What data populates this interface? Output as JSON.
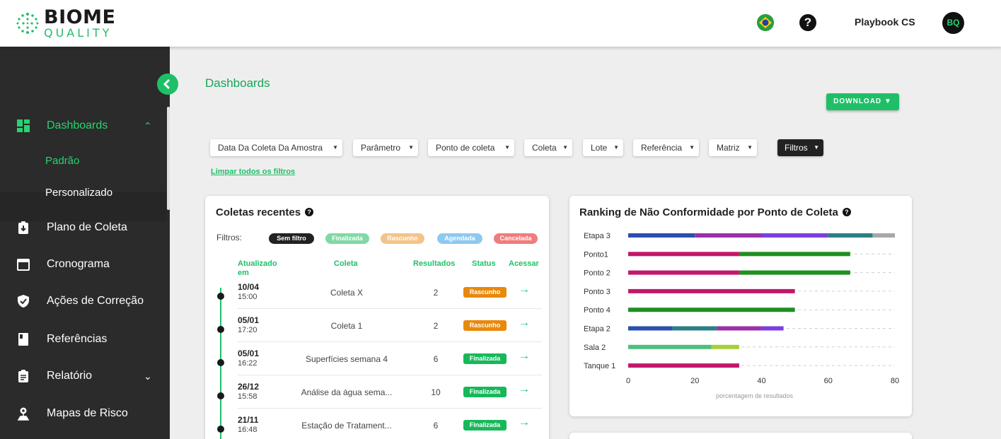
{
  "header": {
    "logo_main": "BIOME",
    "logo_sub": "QUALITY",
    "help": "?",
    "workspace": "Playbook CS",
    "avatar_initials": "BQ"
  },
  "sidebar": {
    "items": [
      {
        "label": "Dashboards",
        "icon": "dashboard-icon",
        "active": true,
        "expanded": true
      },
      {
        "label": "Plano de Coleta",
        "icon": "clipboard-download-icon"
      },
      {
        "label": "Cronograma",
        "icon": "calendar-icon"
      },
      {
        "label": "Ações de Correção",
        "icon": "shield-check-icon"
      },
      {
        "label": "Referências",
        "icon": "book-icon"
      },
      {
        "label": "Relatório",
        "icon": "clipboard-list-icon",
        "has_children": true
      },
      {
        "label": "Mapas de Risco",
        "icon": "map-pin-icon"
      }
    ],
    "subitems": [
      {
        "label": "Padrão",
        "active": true
      },
      {
        "label": "Personalizado"
      }
    ]
  },
  "main": {
    "title": "Dashboards",
    "download_label": "DOWNLOAD",
    "filters": [
      "Data Da Coleta Da Amostra",
      "Parâmetro",
      "Ponto de coleta",
      "Coleta",
      "Lote",
      "Referência",
      "Matriz",
      "Filtros"
    ],
    "clear_filters": "Limpar todos os filtros"
  },
  "recent": {
    "title": "Coletas recentes",
    "help": "?",
    "filters_label": "Filtros:",
    "chips": [
      {
        "label": "Sem filtro",
        "color": "#222222"
      },
      {
        "label": "Finalizada",
        "color": "#7fd9a6"
      },
      {
        "label": "Rascunho",
        "color": "#f3c48a"
      },
      {
        "label": "Agendada",
        "color": "#8ec9ee"
      },
      {
        "label": "Cancelada",
        "color": "#ee7d7d"
      }
    ],
    "columns": {
      "updated": "Atualizado em",
      "coleta": "Coleta",
      "results": "Resultados",
      "status": "Status",
      "access": "Acessar"
    },
    "rows": [
      {
        "date": "10/04",
        "time": "15:00",
        "name": "Coleta X",
        "results": "2",
        "status": "Rascunho",
        "status_color": "#e8890c"
      },
      {
        "date": "05/01",
        "time": "17:20",
        "name": "Coleta 1",
        "results": "2",
        "status": "Rascunho",
        "status_color": "#e8890c"
      },
      {
        "date": "05/01",
        "time": "16:22",
        "name": "Superfícies semana 4",
        "results": "6",
        "status": "Finalizada",
        "status_color": "#17b85a"
      },
      {
        "date": "26/12",
        "time": "15:58",
        "name": "Análise da água sema...",
        "results": "10",
        "status": "Finalizada",
        "status_color": "#17b85a"
      },
      {
        "date": "21/11",
        "time": "16:48",
        "name": "Estação de Tratament...",
        "results": "6",
        "status": "Finalizada",
        "status_color": "#17b85a"
      }
    ]
  },
  "chart_data": {
    "type": "bar",
    "orientation": "horizontal",
    "stacked": true,
    "title": "Ranking de Não Conformidade por Ponto de Coleta",
    "xlabel": "porcentagem de resultados",
    "ylabel": "",
    "xlim": [
      0,
      80
    ],
    "xticks": [
      0,
      20,
      40,
      60,
      80
    ],
    "grid": false,
    "categories": [
      "Etapa 3",
      "Ponto1",
      "Ponto 2",
      "Ponto 3",
      "Ponto 4",
      "Etapa 2",
      "Sala 2",
      "Tanque 1"
    ],
    "rows": [
      {
        "category": "Etapa 3",
        "segments": [
          {
            "value": 20,
            "color": "#2a4fb0"
          },
          {
            "value": 20,
            "color": "#9b30a8"
          },
          {
            "value": 20,
            "color": "#7b3fe0"
          },
          {
            "value": 13.3,
            "color": "#2b7f86"
          },
          {
            "value": 6.7,
            "color": "#a8a8a8"
          }
        ]
      },
      {
        "category": "Ponto1",
        "segments": [
          {
            "value": 33.3,
            "color": "#c2186a"
          },
          {
            "value": 33.3,
            "color": "#1f8f1f"
          }
        ]
      },
      {
        "category": "Ponto 2",
        "segments": [
          {
            "value": 33.3,
            "color": "#c2186a"
          },
          {
            "value": 33.3,
            "color": "#1f8f1f"
          }
        ]
      },
      {
        "category": "Ponto 3",
        "segments": [
          {
            "value": 50,
            "color": "#c2186a"
          }
        ]
      },
      {
        "category": "Ponto 4",
        "segments": [
          {
            "value": 50,
            "color": "#1f8f1f"
          }
        ]
      },
      {
        "category": "Etapa 2",
        "segments": [
          {
            "value": 13.3,
            "color": "#2a4fb0"
          },
          {
            "value": 13.3,
            "color": "#2b7f86"
          },
          {
            "value": 13.3,
            "color": "#9b30a8"
          },
          {
            "value": 6.7,
            "color": "#7b3fe0"
          }
        ]
      },
      {
        "category": "Sala 2",
        "segments": [
          {
            "value": 25,
            "color": "#4fbf7f"
          },
          {
            "value": 8.3,
            "color": "#a6cf3a"
          }
        ]
      },
      {
        "category": "Tanque 1",
        "segments": [
          {
            "value": 33.3,
            "color": "#c2186a"
          }
        ]
      }
    ]
  },
  "colors": {
    "brand_green": "#1fbf68",
    "sidebar_bg": "#2b2b2b",
    "page_bg": "#eeeeee"
  }
}
